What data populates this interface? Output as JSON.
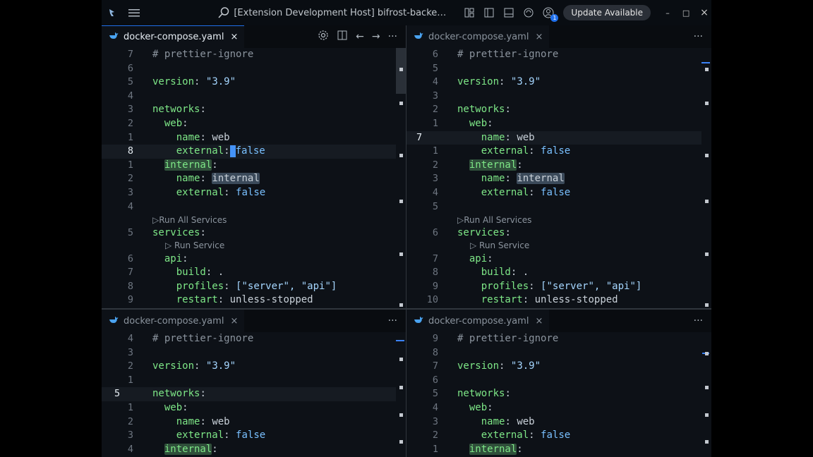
{
  "titlebar": {
    "title": "[Extension Development Host] bifrost-backend - Winds…",
    "update_label": "Update Available",
    "badge_count": "1",
    "minimize": "–",
    "maximize": "□",
    "close": "×"
  },
  "panes": {
    "top_left": {
      "tab": {
        "label": "docker-compose.yaml",
        "close": "×"
      },
      "lines": [
        "7",
        "6",
        "5",
        "4",
        "3",
        "2",
        "1",
        "8",
        "1",
        "2",
        "3",
        "4",
        "5",
        "6",
        "7",
        "8",
        "9"
      ]
    },
    "top_right": {
      "tab": {
        "label": "docker-compose.yaml",
        "close": "×"
      },
      "lines": [
        "6",
        "5",
        "4",
        "3",
        "2",
        "1",
        "7",
        "1",
        "2",
        "3",
        "4",
        "5",
        "6",
        "7",
        "8",
        "9",
        "10"
      ]
    },
    "bottom_left": {
      "tab": {
        "label": "docker-compose.yaml",
        "close": "×"
      },
      "lines": [
        "4",
        "3",
        "2",
        "1",
        "5",
        "1",
        "2",
        "3",
        "4"
      ]
    },
    "bottom_right": {
      "tab": {
        "label": "docker-compose.yaml",
        "close": "×"
      },
      "lines": [
        "9",
        "8",
        "7",
        "6",
        "5",
        "4",
        "3",
        "2",
        "1"
      ]
    }
  },
  "code": {
    "comment": "# prettier-ignore",
    "version_key": "version",
    "version_val": "\"3.9\"",
    "networks_key": "networks",
    "web_key": "web",
    "name_key": "name",
    "web_name": "web",
    "external_key": "external",
    "false_val": "false",
    "internal_key": "internal",
    "internal_name": "internal",
    "services_key": "services",
    "api_key": "api",
    "build_key": "build",
    "build_val": ".",
    "profiles_key": "profiles",
    "profiles_val": "[\"server\", \"api\"]",
    "restart_key": "restart",
    "restart_val": "unless-stopped",
    "colon": ":"
  },
  "codelens": {
    "run_all": "Run All Services",
    "run_service": "Run Service"
  },
  "icons": {
    "more": "···",
    "arrow_left": "←",
    "arrow_right": "→"
  },
  "colors": {
    "key": "#7ee787",
    "string": "#a5d6ff",
    "boolean": "#79c0ff",
    "accent": "#1f6feb"
  }
}
